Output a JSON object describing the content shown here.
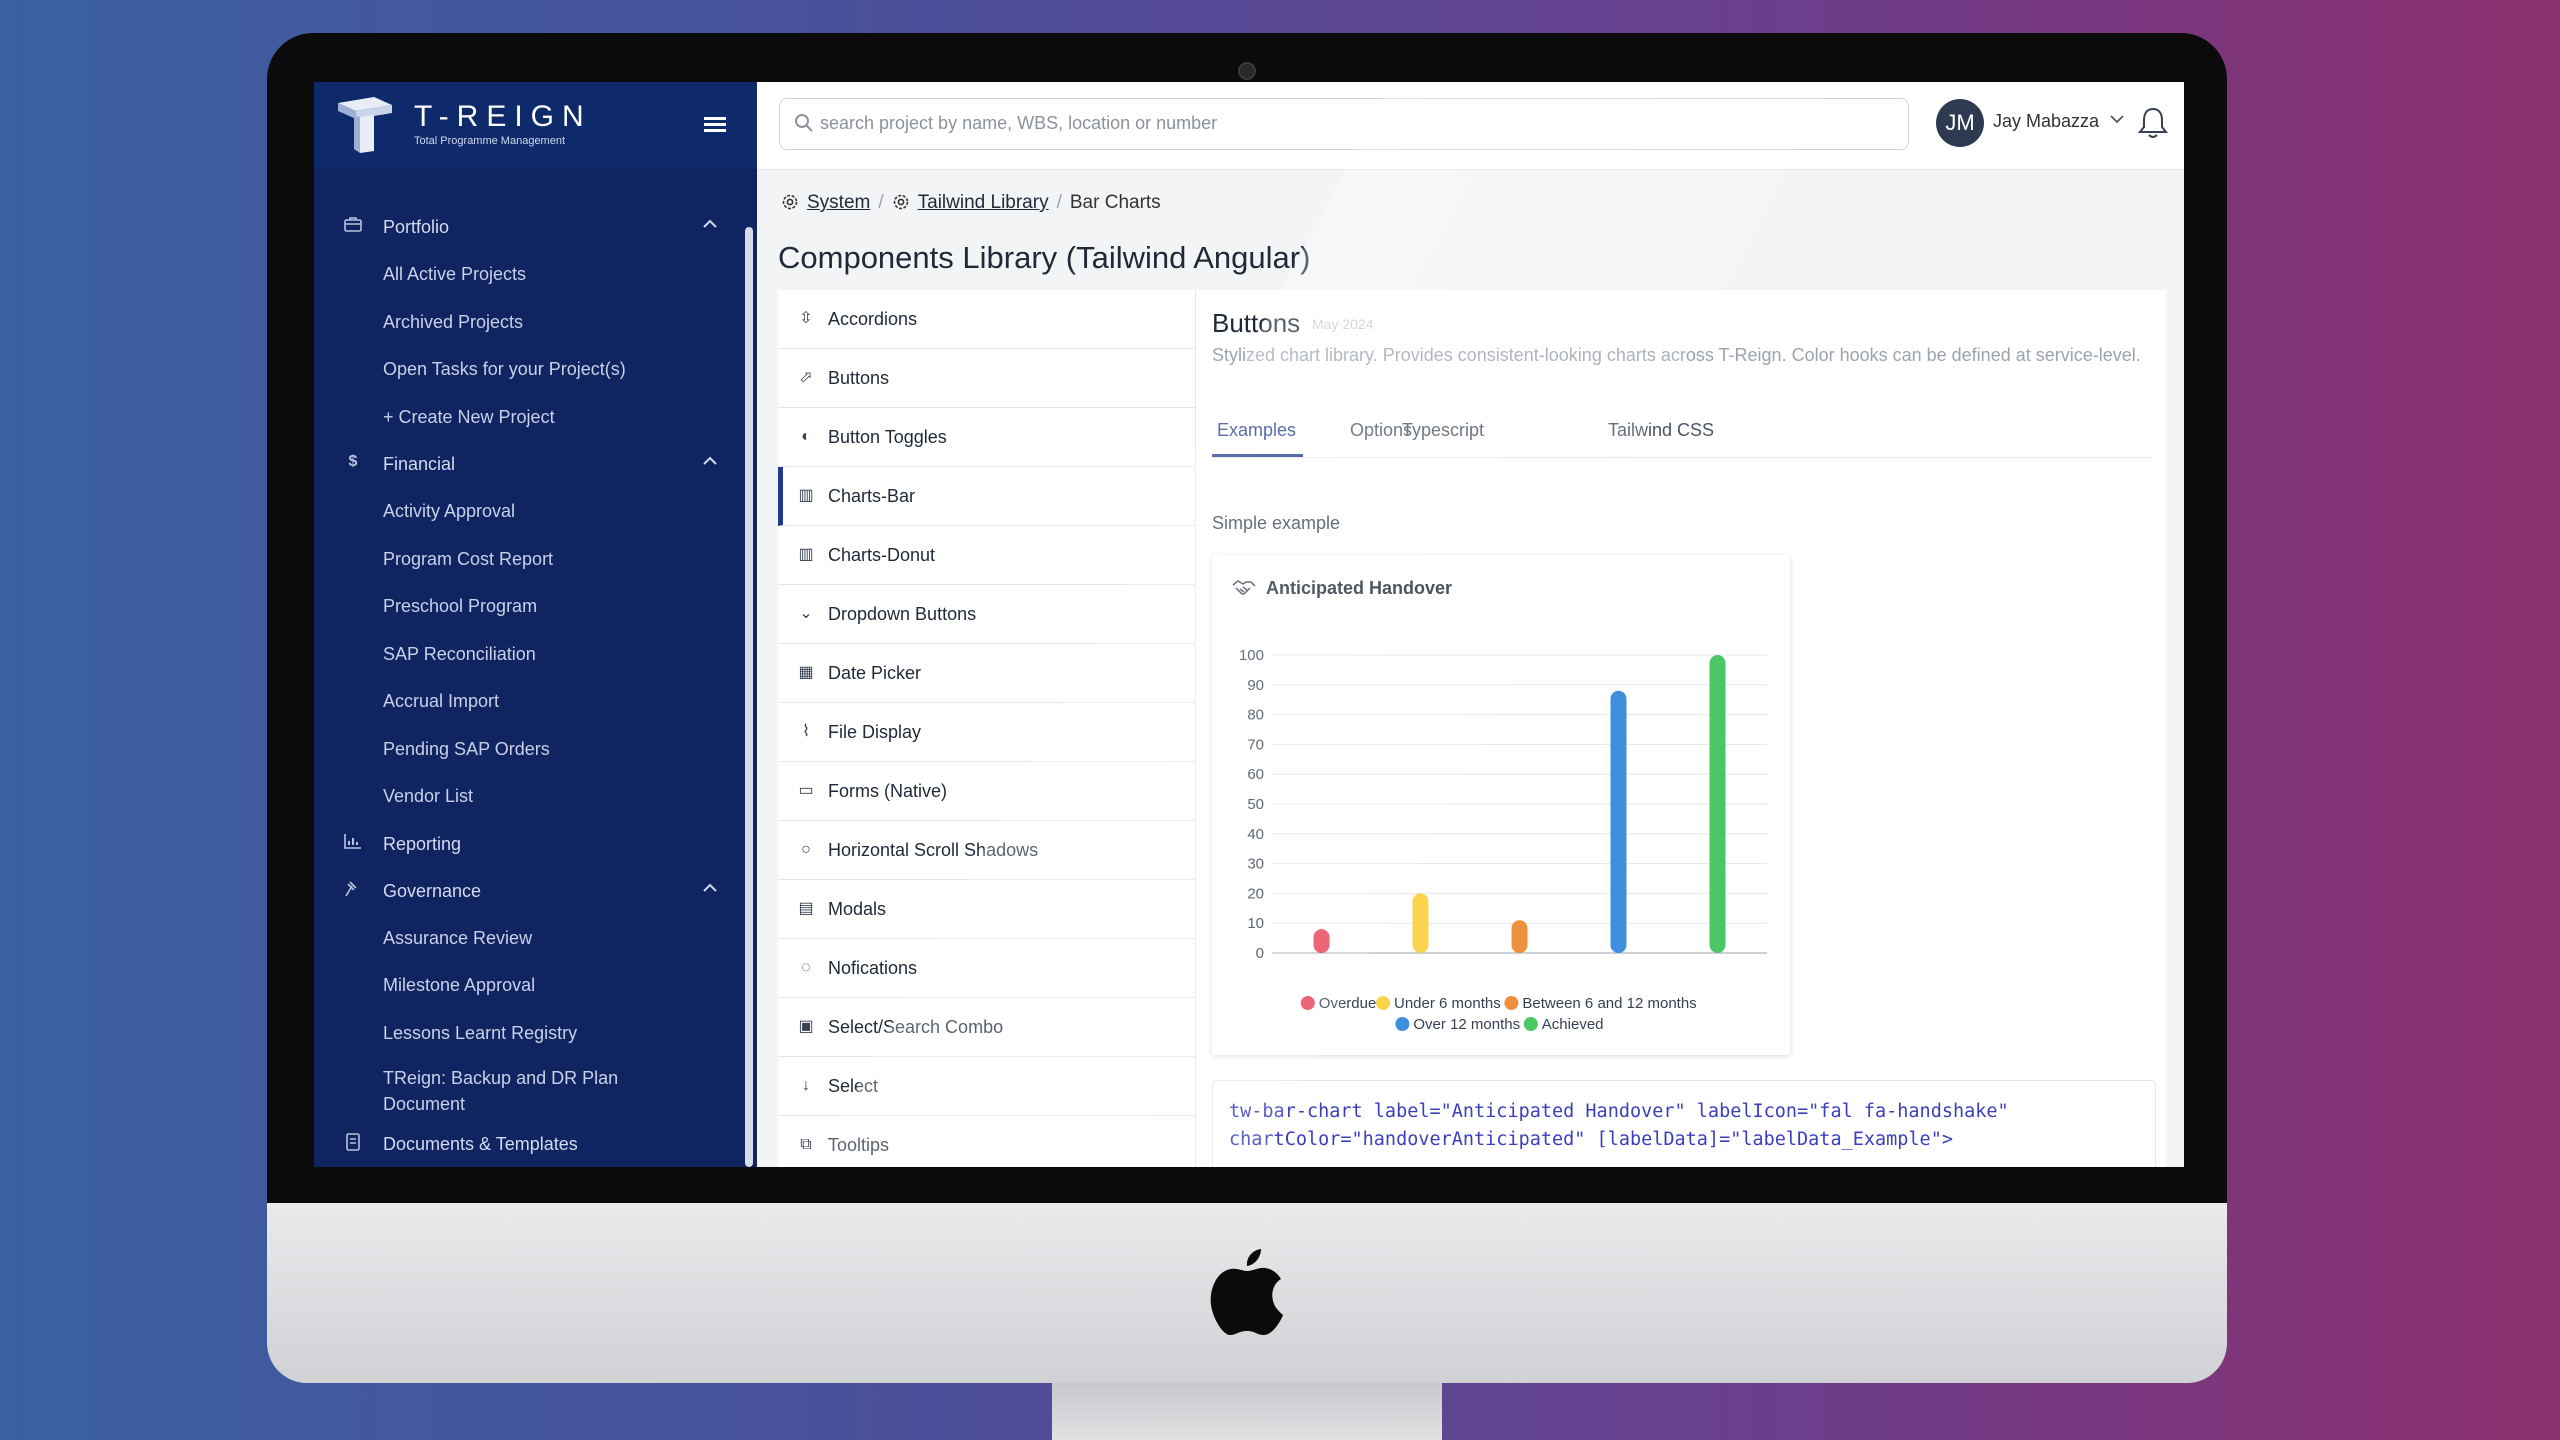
{
  "brand": {
    "name": "T-REIGN",
    "tagline": "Total Programme Management"
  },
  "sidebar": {
    "sections": [
      {
        "icon": "briefcase-icon",
        "label": "Portfolio",
        "expanded": true,
        "items": [
          "All Active Projects",
          "Archived Projects",
          "Open Tasks for your Project(s)",
          "+ Create New Project"
        ]
      },
      {
        "icon": "dollar-icon",
        "label": "Financial",
        "expanded": true,
        "items": [
          "Activity Approval",
          "Program Cost Report",
          "Preschool Program",
          "SAP Reconciliation",
          "Accrual Import",
          "Pending SAP Orders",
          "Vendor List"
        ]
      },
      {
        "icon": "chart-icon",
        "label": "Reporting",
        "expanded": false,
        "items": []
      },
      {
        "icon": "gavel-icon",
        "label": "Governance",
        "expanded": true,
        "items": [
          "Assurance Review",
          "Milestone Approval",
          "Lessons Learnt Registry",
          "TReign: Backup and DR Plan Document"
        ]
      },
      {
        "icon": "document-icon",
        "label": "Documents & Templates",
        "expanded": false,
        "items": []
      }
    ]
  },
  "topbar": {
    "search_placeholder": "search project by name, WBS, location or number",
    "user_initials": "JM",
    "user_name": "Jay Mabazza"
  },
  "breadcrumb": [
    "System",
    "Tailwind Library",
    "Bar Charts"
  ],
  "page_title": "Components Library (Tailwind Angular)",
  "library": {
    "active": "Charts-Bar",
    "items": [
      {
        "icon": "accordion-icon",
        "label": "Accordions"
      },
      {
        "icon": "pointer-icon",
        "label": "Buttons"
      },
      {
        "icon": "toggle-icon",
        "label": "Button Toggles"
      },
      {
        "icon": "bar-chart-icon",
        "label": "Charts-Bar"
      },
      {
        "icon": "bar-chart-icon",
        "label": "Charts-Donut"
      },
      {
        "icon": "chevron-down-icon",
        "label": "Dropdown Buttons"
      },
      {
        "icon": "calendar-icon",
        "label": "Date Picker"
      },
      {
        "icon": "paperclip-icon",
        "label": "File Display"
      },
      {
        "icon": "input-icon",
        "label": "Forms (Native)"
      },
      {
        "icon": "circle-icon",
        "label": "Horizontal Scroll Shadows"
      },
      {
        "icon": "window-icon",
        "label": "Modals"
      },
      {
        "icon": "comment-icon",
        "label": "Nofications"
      },
      {
        "icon": "combo-icon",
        "label": "Select/Search Combo"
      },
      {
        "icon": "arrow-down-icon",
        "label": "Select"
      },
      {
        "icon": "tooltip-icon",
        "label": "Tooltips"
      }
    ]
  },
  "panel": {
    "title": "Buttons",
    "date": "May 2024",
    "description": "Stylized chart library. Provides consistent-looking charts across T-Reign. Color hooks can be defined at service-level.",
    "tabs": [
      "Examples",
      "Options",
      "Typescript",
      "Tailwind CSS"
    ],
    "active_tab": "Examples",
    "section_label": "Simple example",
    "code_lines": [
      "tw-bar-chart label=\"Anticipated Handover\" labelIcon=\"fal fa-handshake\"",
      "chartColor=\"handoverAnticipated\" [labelData]=\"labelData_Example\">"
    ]
  },
  "chart_data": {
    "type": "bar",
    "title": "Anticipated Handover",
    "categories": [
      "Overdue",
      "Under 6 months",
      "Between 6 and 12 months",
      "Over 12 months",
      "Achieved"
    ],
    "values": [
      8,
      20,
      11,
      88,
      100
    ],
    "colors": [
      "#e8485c",
      "#fcd34d",
      "#f0903c",
      "#3f8fdc",
      "#4cc766"
    ],
    "ylim": [
      0,
      100
    ],
    "yticks": [
      0,
      10,
      20,
      30,
      40,
      50,
      60,
      70,
      80,
      90,
      100
    ],
    "grid": true,
    "legend_position": "bottom"
  }
}
